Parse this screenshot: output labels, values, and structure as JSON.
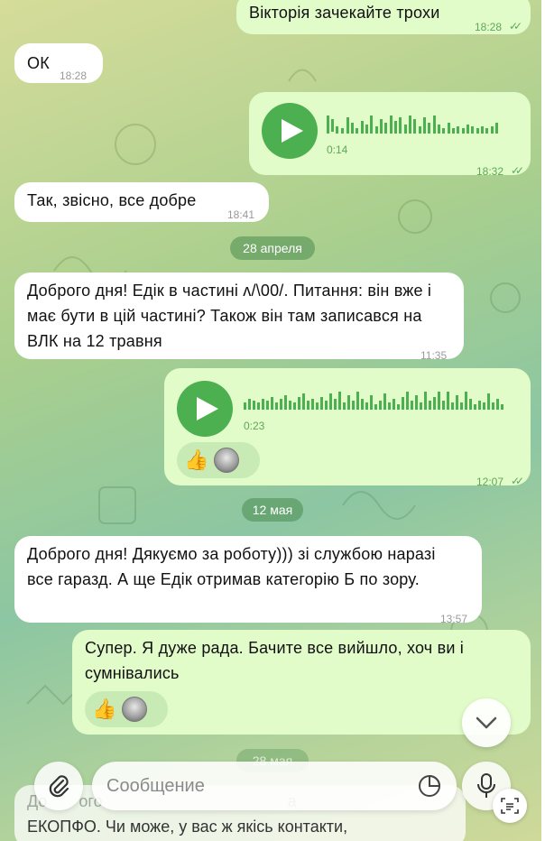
{
  "colors": {
    "incoming_bubble": "#ffffff",
    "outgoing_bubble": "#e1fbc9",
    "accent_green": "#4caf50",
    "time_outgoing": "#5ea85a",
    "time_incoming": "#9a9a9a"
  },
  "messages": [
    {
      "dir": "out",
      "text": "Вікторія зачекайте трохи",
      "time": "18:28"
    },
    {
      "dir": "in",
      "text": "ОК",
      "time": "18:28"
    },
    {
      "dir": "out",
      "type": "voice",
      "duration": "0:14",
      "time": "18:32"
    },
    {
      "dir": "in",
      "text": "Так, звісно, все добре",
      "time": "18:41"
    },
    {
      "dir": "in",
      "text": "Доброго дня! Едік в частині ʌ/\\00/. Питання: він вже і має бути в цій частині? Також він там записався на ВЛК на 12 травня",
      "time": "11:35"
    },
    {
      "dir": "out",
      "type": "voice",
      "duration": "0:23",
      "time": "12:07",
      "reaction_emoji": "👍"
    },
    {
      "dir": "in",
      "text": "Доброго дня! Дякуємо за роботу))) зі службою наразі все гаразд. А ще Едік отримав категорію Б по зору.",
      "time": "13:57"
    },
    {
      "dir": "out",
      "text": "Супер. Я дуже рада. Бачите все вийшло, хоч ви і сумнівались",
      "reaction_emoji": "👍"
    }
  ],
  "dates": [
    "28 апреля",
    "12 мая",
    "28 мая"
  ],
  "peek_text": "ЕКОПФО. Чи може, у вас ж якісь контакти,",
  "peek_top_text": "До       ого                                         а",
  "composer": {
    "placeholder": "Сообщение"
  },
  "icons": {
    "attach": "paperclip-icon",
    "sticker": "sticker-icon",
    "mic": "microphone-icon",
    "scroll": "chevron-down-icon",
    "scan": "text-scan-icon",
    "play": "play-icon",
    "read": "double-check-icon"
  }
}
